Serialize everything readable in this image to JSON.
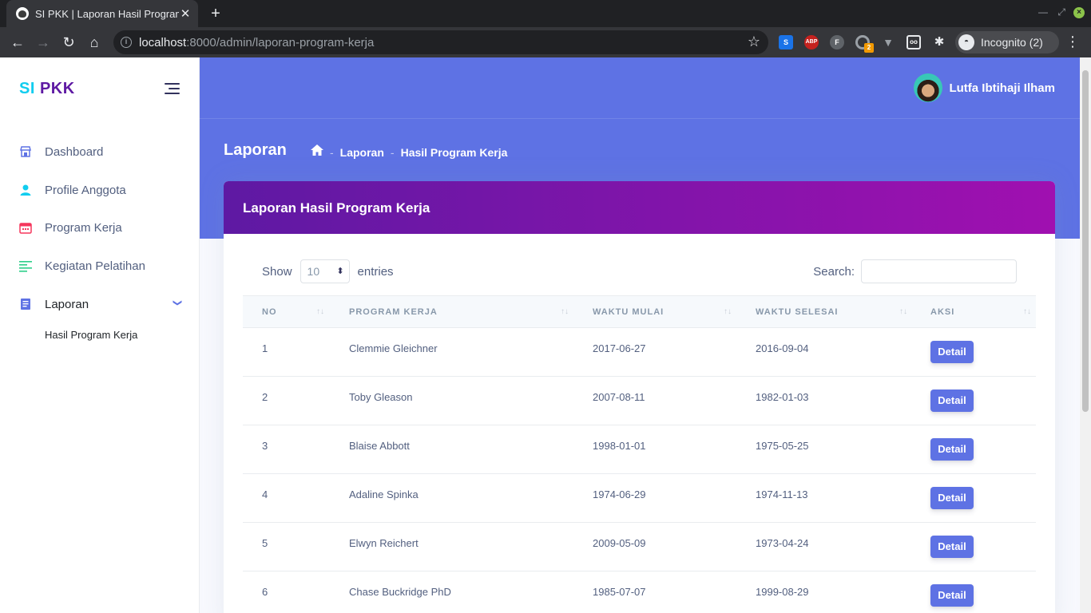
{
  "browser": {
    "tab_title": "SI PKK | Laporan Hasil Program Kerja",
    "url_host": "localhost",
    "url_rest": ":8000/admin/laporan-program-kerja",
    "incognito_label": "Incognito (2)",
    "extension_badge": "2"
  },
  "sidebar": {
    "brand_si": "SI",
    "brand_pkk": "PKK",
    "items": [
      {
        "label": "Dashboard",
        "icon": "store-icon"
      },
      {
        "label": "Profile Anggota",
        "icon": "user-icon"
      },
      {
        "label": "Program Kerja",
        "icon": "calendar-icon"
      },
      {
        "label": "Kegiatan Pelatihan",
        "icon": "align-left-icon"
      },
      {
        "label": "Laporan",
        "icon": "document-icon"
      }
    ],
    "sub_item": "Hasil Program Kerja"
  },
  "header": {
    "user_name": "Lutfa Ibtihaji Ilham",
    "page_title": "Laporan",
    "breadcrumb": [
      "Laporan",
      "Hasil Program Kerja"
    ]
  },
  "card": {
    "title": "Laporan Hasil Program Kerja",
    "show_label": "Show",
    "entries_value": "10",
    "entries_label": "entries",
    "search_label": "Search:"
  },
  "table": {
    "columns": [
      "NO",
      "PROGRAM KERJA",
      "WAKTU MULAI",
      "WAKTU SELESAI",
      "AKSI"
    ],
    "rows": [
      {
        "no": "1",
        "program": "Clemmie Gleichner",
        "mulai": "2017-06-27",
        "selesai": "2016-09-04",
        "aksi": "Detail"
      },
      {
        "no": "2",
        "program": "Toby Gleason",
        "mulai": "2007-08-11",
        "selesai": "1982-01-03",
        "aksi": "Detail"
      },
      {
        "no": "3",
        "program": "Blaise Abbott",
        "mulai": "1998-01-01",
        "selesai": "1975-05-25",
        "aksi": "Detail"
      },
      {
        "no": "4",
        "program": "Adaline Spinka",
        "mulai": "1974-06-29",
        "selesai": "1974-11-13",
        "aksi": "Detail"
      },
      {
        "no": "5",
        "program": "Elwyn Reichert",
        "mulai": "2009-05-09",
        "selesai": "1973-04-24",
        "aksi": "Detail"
      },
      {
        "no": "6",
        "program": "Chase Buckridge PhD",
        "mulai": "1985-07-07",
        "selesai": "1999-08-29",
        "aksi": "Detail"
      }
    ]
  },
  "colors": {
    "primary": "#5e72e4",
    "card_header_start": "#5e19a3",
    "card_header_end": "#a010b0",
    "brand_si": "#11cdef",
    "brand_pkk": "#5e19a3"
  }
}
